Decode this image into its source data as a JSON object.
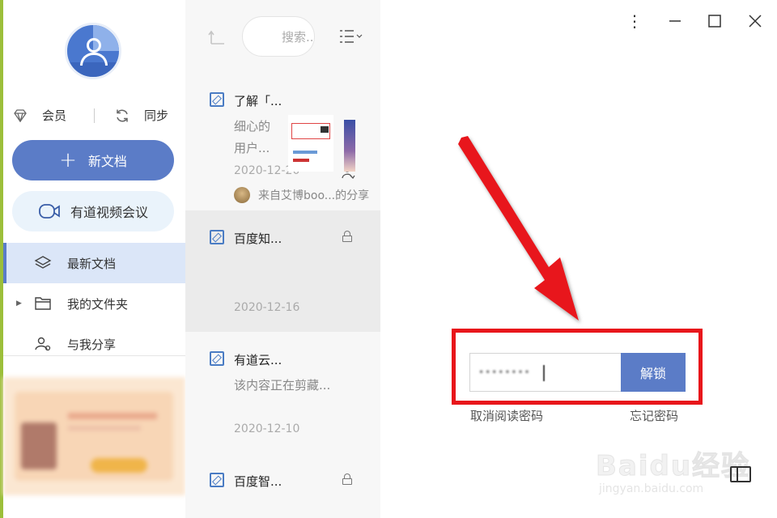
{
  "sidebar": {
    "vip_label": "会员",
    "sync_label": "同步",
    "new_doc_label": "新文档",
    "meeting_label": "有道视频会议",
    "nav": [
      {
        "label": "最新文档"
      },
      {
        "label": "我的文件夹"
      },
      {
        "label": "与我分享"
      }
    ]
  },
  "doclist": {
    "search_placeholder": "搜索...",
    "docs": [
      {
        "title": "了解「...",
        "line1": "细心的",
        "line2": "用户...",
        "date": "2020-12-20",
        "shared_from": "来自艾博boo...的分享"
      },
      {
        "title": "百度知...",
        "date": "2020-12-16"
      },
      {
        "title": "有道云...",
        "line1": "该内容正在剪藏...",
        "date": "2020-12-10"
      },
      {
        "title": "百度智..."
      }
    ]
  },
  "main": {
    "password_masked": "••••••••",
    "unlock_label": "解锁",
    "cancel_password_link": "取消阅读密码",
    "forgot_password_link": "忘记密码",
    "watermark_text": "Baidu经验",
    "watermark_url": "jingyan.baidu.com"
  },
  "colors": {
    "accent": "#5b7cc7",
    "highlight_red": "#e8161b",
    "active_nav_bg": "#dbe6f8",
    "meeting_bg": "#eaf3fb"
  }
}
